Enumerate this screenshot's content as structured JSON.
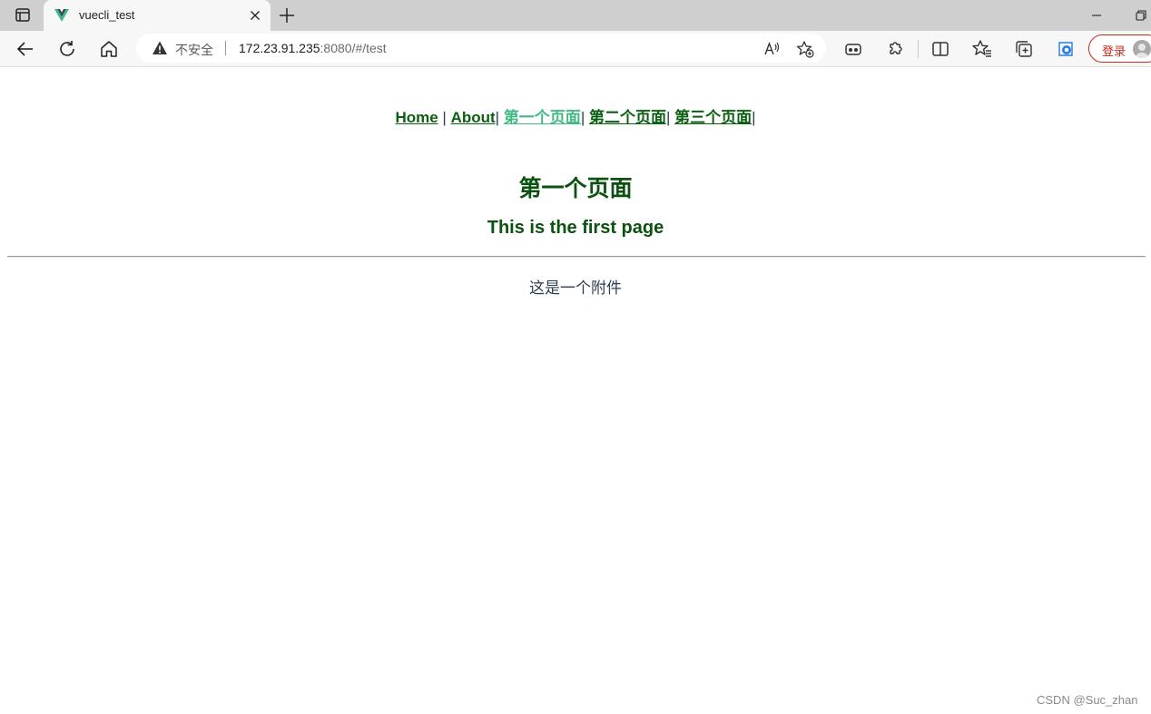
{
  "browser": {
    "tab": {
      "title": "vuecli_test",
      "favicon": "vue-logo-icon"
    },
    "address_bar": {
      "security_label": "不安全",
      "host": "172.23.91.235",
      "rest": ":8080/#/test"
    },
    "profile": {
      "login_label": "登录"
    },
    "icons": [
      "tab-actions-icon",
      "close-icon",
      "new-tab-icon",
      "minimize-icon",
      "restore-icon",
      "back-icon",
      "refresh-icon",
      "home-icon",
      "warning-icon",
      "read-aloud-icon",
      "add-favorite-icon",
      "extensions-icon",
      "split-screen-icon",
      "favorites-icon",
      "collections-icon",
      "copilot-icon",
      "avatar-icon"
    ]
  },
  "page": {
    "nav": {
      "items": [
        {
          "label": "Home",
          "active": false,
          "sep": " | "
        },
        {
          "label": "About",
          "active": false,
          "sep": "| "
        },
        {
          "label": "第一个页面",
          "active": true,
          "sep": "| "
        },
        {
          "label": "第二个页面",
          "active": false,
          "sep": "| "
        },
        {
          "label": "第三个页面",
          "active": false,
          "sep": "|"
        }
      ]
    },
    "heading": "第一个页面",
    "subheading": "This is the first page",
    "attachment_text": "这是一个附件",
    "watermark": "CSDN @Suc_zhan"
  },
  "colors": {
    "link": "#0b5f10",
    "active_link": "#42b983",
    "heading": "#0b5210",
    "text": "#2c3e50",
    "login": "#c42b1c"
  }
}
